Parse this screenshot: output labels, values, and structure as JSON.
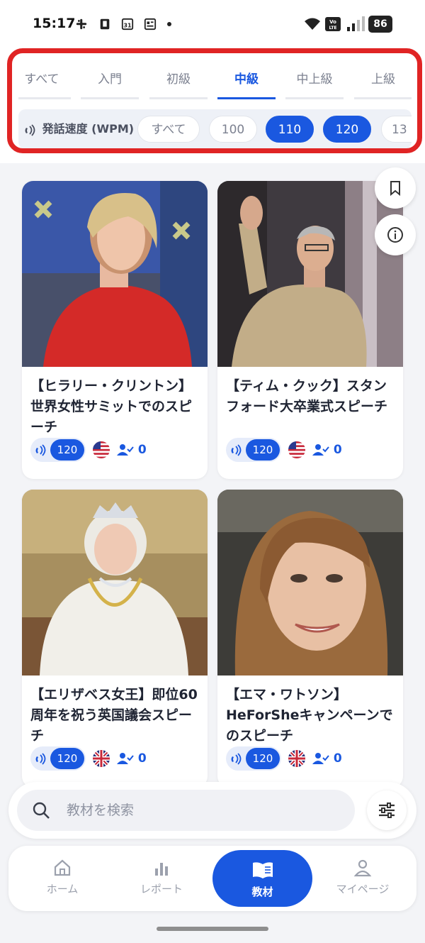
{
  "status_bar": {
    "time": "15:17",
    "battery": "86",
    "network_badge": "Vo LTE"
  },
  "level_tabs": [
    {
      "label": "すべて",
      "active": false
    },
    {
      "label": "入門",
      "active": false
    },
    {
      "label": "初級",
      "active": false
    },
    {
      "label": "中級",
      "active": true
    },
    {
      "label": "中上級",
      "active": false
    },
    {
      "label": "上級",
      "active": false
    }
  ],
  "speed_filter": {
    "label": "発話速度 (WPM)",
    "chips": [
      {
        "label": "すべて",
        "selected": false
      },
      {
        "label": "100",
        "selected": false
      },
      {
        "label": "110",
        "selected": true
      },
      {
        "label": "120",
        "selected": true
      },
      {
        "label": "13",
        "selected": false
      }
    ]
  },
  "cards": [
    {
      "title": "【ヒラリー・クリントン】世界女性サミットでのスピーチ",
      "wpm": "120",
      "flag": "us-flag",
      "learners": "0"
    },
    {
      "title": "【ティム・クック】スタンフォード大卒業式スピーチ",
      "wpm": "120",
      "flag": "us-flag",
      "learners": "0"
    },
    {
      "title": "【エリザベス女王】即位60周年を祝う英国議会スピーチ",
      "wpm": "120",
      "flag": "uk-flag",
      "learners": "0"
    },
    {
      "title": "【エマ・ワトソン】HeForSheキャンペーンでのスピーチ",
      "wpm": "120",
      "flag": "uk-flag",
      "learners": "0"
    }
  ],
  "search": {
    "placeholder": "教材を検索",
    "value": ""
  },
  "bottom_nav": [
    {
      "label": "ホーム",
      "icon": "home-icon",
      "active": false
    },
    {
      "label": "レポート",
      "icon": "chart-icon",
      "active": false
    },
    {
      "label": "教材",
      "icon": "book-icon",
      "active": true
    },
    {
      "label": "マイページ",
      "icon": "user-icon",
      "active": false
    }
  ],
  "colors": {
    "accent": "#1a58e0",
    "highlight_border": "#e02424",
    "background": "#f3f4f7"
  }
}
